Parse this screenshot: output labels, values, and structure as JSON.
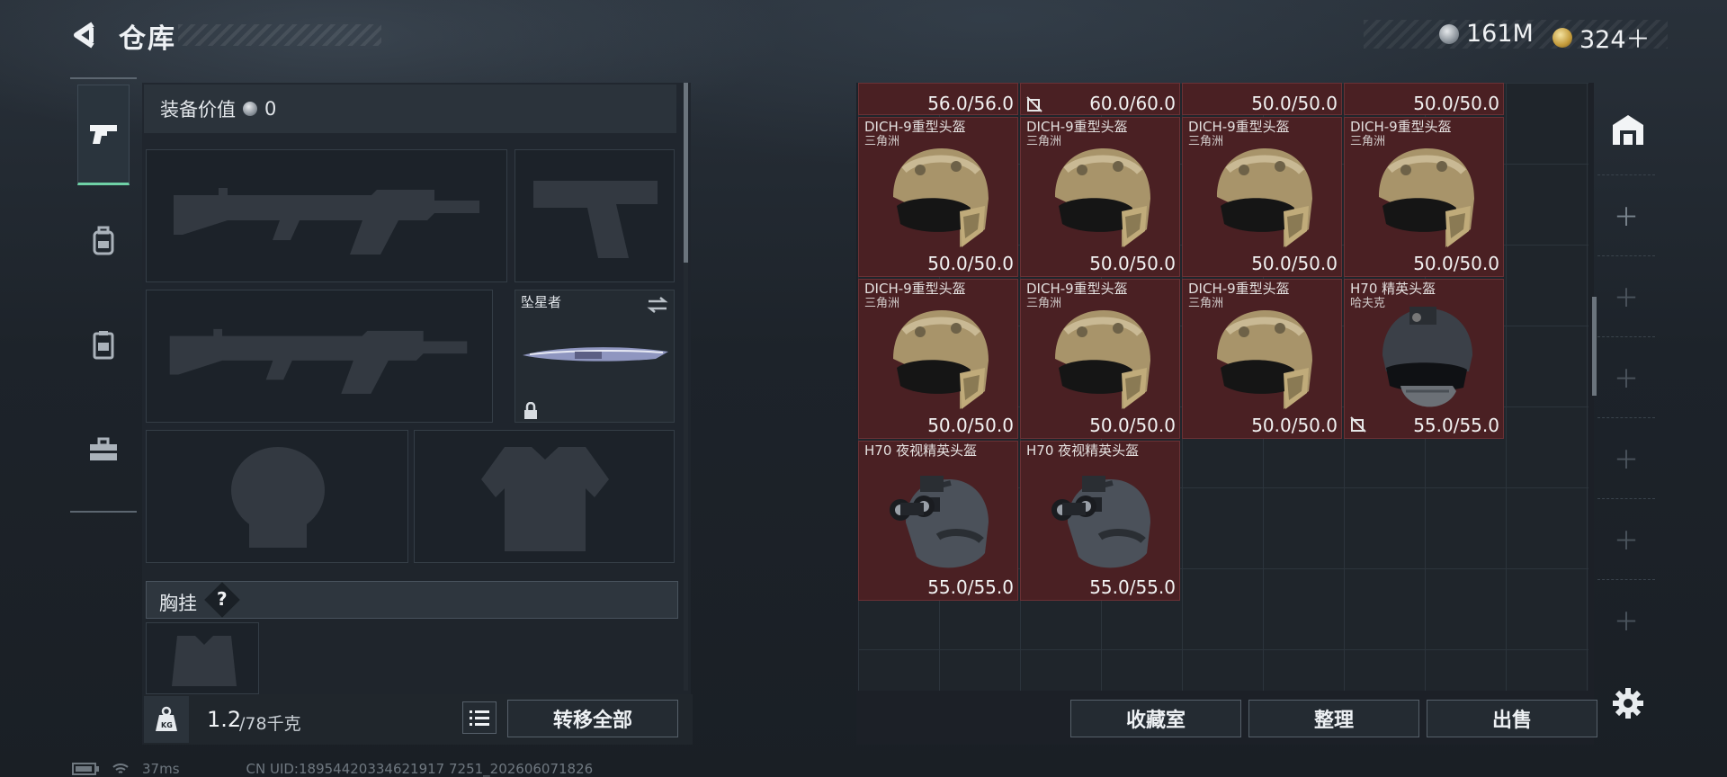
{
  "header": {
    "title": "仓库",
    "currency1": "161M",
    "currency2": "324＋"
  },
  "colors": {
    "accent": "#6fd1a6",
    "item_bg": "#4a2023",
    "panel": "#20262c"
  },
  "nav": [
    "pistol-icon",
    "backpack-icon",
    "vest-icon",
    "toolbox-icon"
  ],
  "loadout": {
    "value_label": "装备价值",
    "value": "0",
    "melee_name": "坠星者",
    "chest_label": "胸挂",
    "chest_help": "?",
    "weight_current": "1.2",
    "weight_max": "/78千克",
    "transfer_all": "转移全部"
  },
  "storage": {
    "top_row": [
      "56.0/56.0",
      "60.0/60.0",
      "50.0/50.0",
      "50.0/50.0"
    ],
    "items": [
      {
        "name": "DICH-9重型头盔",
        "brand": "三角洲",
        "durability": "50.0/50.0",
        "kind": "tan"
      },
      {
        "name": "DICH-9重型头盔",
        "brand": "三角洲",
        "durability": "50.0/50.0",
        "kind": "tan"
      },
      {
        "name": "DICH-9重型头盔",
        "brand": "三角洲",
        "durability": "50.0/50.0",
        "kind": "tan"
      },
      {
        "name": "DICH-9重型头盔",
        "brand": "三角洲",
        "durability": "50.0/50.0",
        "kind": "tan"
      },
      {
        "name": "DICH-9重型头盔",
        "brand": "三角洲",
        "durability": "50.0/50.0",
        "kind": "tan"
      },
      {
        "name": "DICH-9重型头盔",
        "brand": "三角洲",
        "durability": "50.0/50.0",
        "kind": "tan"
      },
      {
        "name": "DICH-9重型头盔",
        "brand": "三角洲",
        "durability": "50.0/50.0",
        "kind": "tan"
      },
      {
        "name": "H70 精英头盔",
        "brand": "哈夫克",
        "durability": "55.0/55.0",
        "kind": "black"
      },
      {
        "name": "H70 夜视精英头盔",
        "brand": "",
        "durability": "55.0/55.0",
        "kind": "nvg"
      },
      {
        "name": "H70 夜视精英头盔",
        "brand": "",
        "durability": "55.0/55.0",
        "kind": "nvg"
      }
    ],
    "collection": "收藏室",
    "sort": "整理",
    "sell": "出售"
  },
  "status": {
    "ping": "37ms",
    "uid": "CN UID:18954420334621917 7251_202606071826"
  }
}
